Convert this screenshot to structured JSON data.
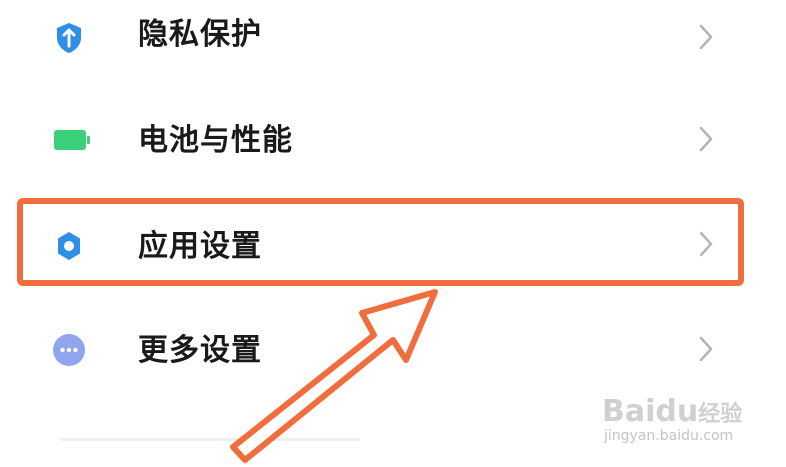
{
  "settings": {
    "items": [
      {
        "label": "隐私保护",
        "icon": "shield-icon",
        "color": "#2e8fe8"
      },
      {
        "label": "电池与性能",
        "icon": "battery-icon",
        "color": "#3ccf7a"
      },
      {
        "label": "应用设置",
        "icon": "gear-icon",
        "color": "#2f8fe6"
      },
      {
        "label": "更多设置",
        "icon": "more-dots-icon",
        "color": "#8fa6ee"
      }
    ],
    "highlight_color": "#f26d3d"
  },
  "watermark": {
    "logo": "Bai",
    "logo_mid": "du",
    "logo_cn": "经验",
    "url": "jingyan.baidu.com"
  }
}
